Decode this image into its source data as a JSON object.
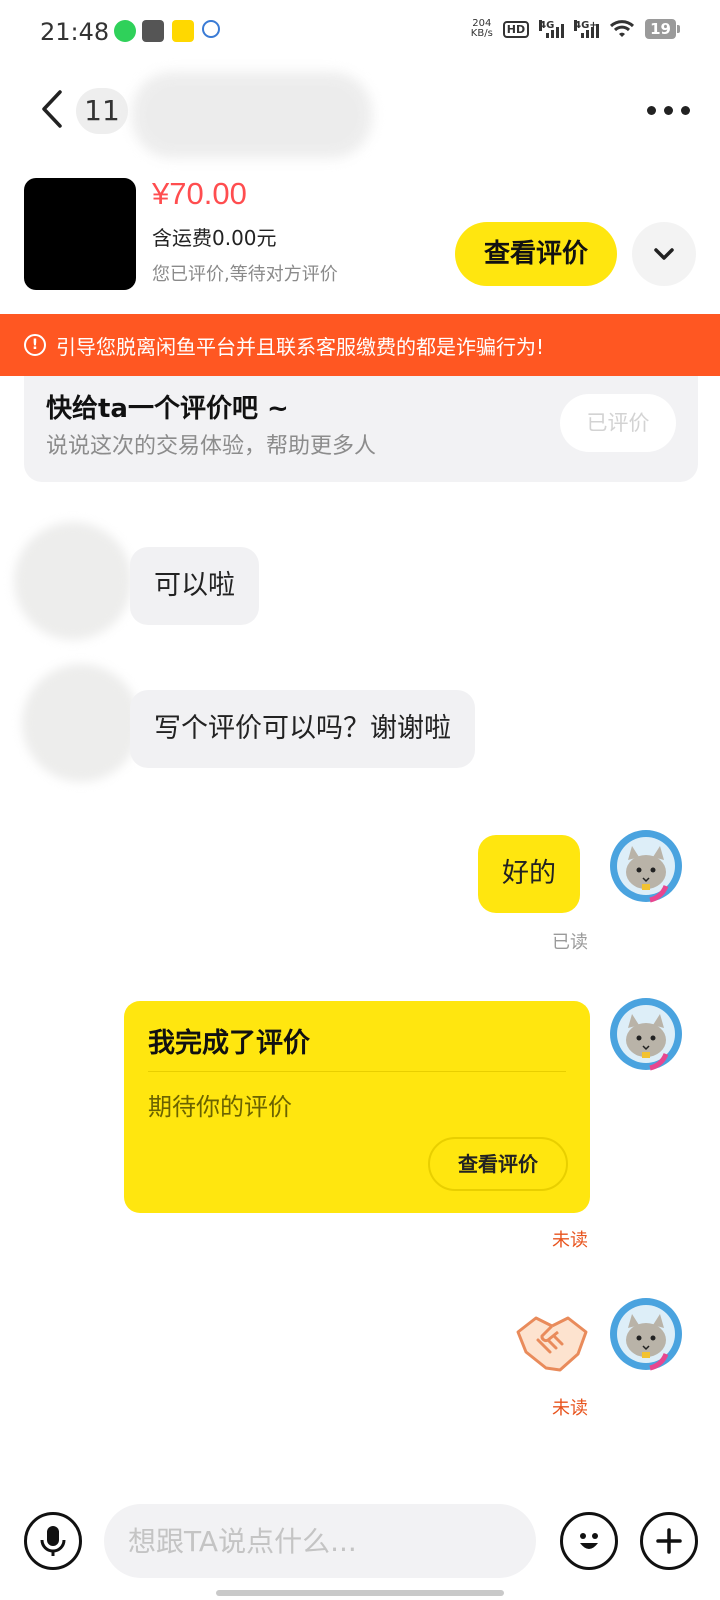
{
  "status_bar": {
    "time": "21:48",
    "net_speed_value": "204",
    "net_speed_unit": "KB/s",
    "hd_label": "HD",
    "signal_1": "4G",
    "signal_2": "4G+",
    "battery": "19"
  },
  "nav": {
    "unread_count": "11"
  },
  "product": {
    "price": "¥70.00",
    "shipping": "含运费0.00元",
    "eval_status": "您已评价,等待对方评价",
    "view_eval_button": "查看评价"
  },
  "warning": {
    "text": "引导您脱离闲鱼平台并且联系客服缴费的都是诈骗行为!"
  },
  "review_prompt": {
    "title": "快给ta一个评价吧 ~",
    "subtitle": "说说这次的交易体验，帮助更多人",
    "button": "已评价"
  },
  "messages": [
    {
      "from": "other",
      "text": "可以啦"
    },
    {
      "from": "other",
      "text": "写个评价可以吗？谢谢啦"
    },
    {
      "from": "self",
      "text": "好的",
      "status": "已读"
    },
    {
      "from": "self",
      "card_title": "我完成了评价",
      "card_subtitle": "期待你的评价",
      "card_button": "查看评价",
      "status": "未读"
    },
    {
      "from": "self",
      "sticker": "handshake",
      "status": "未读"
    }
  ],
  "input_bar": {
    "placeholder": "想跟TA说点什么..."
  },
  "colors": {
    "accent_yellow": "#ffe60f",
    "price_red": "#ff4d4f",
    "warning_orange": "#ff5722",
    "unread_red": "#e8541e"
  }
}
